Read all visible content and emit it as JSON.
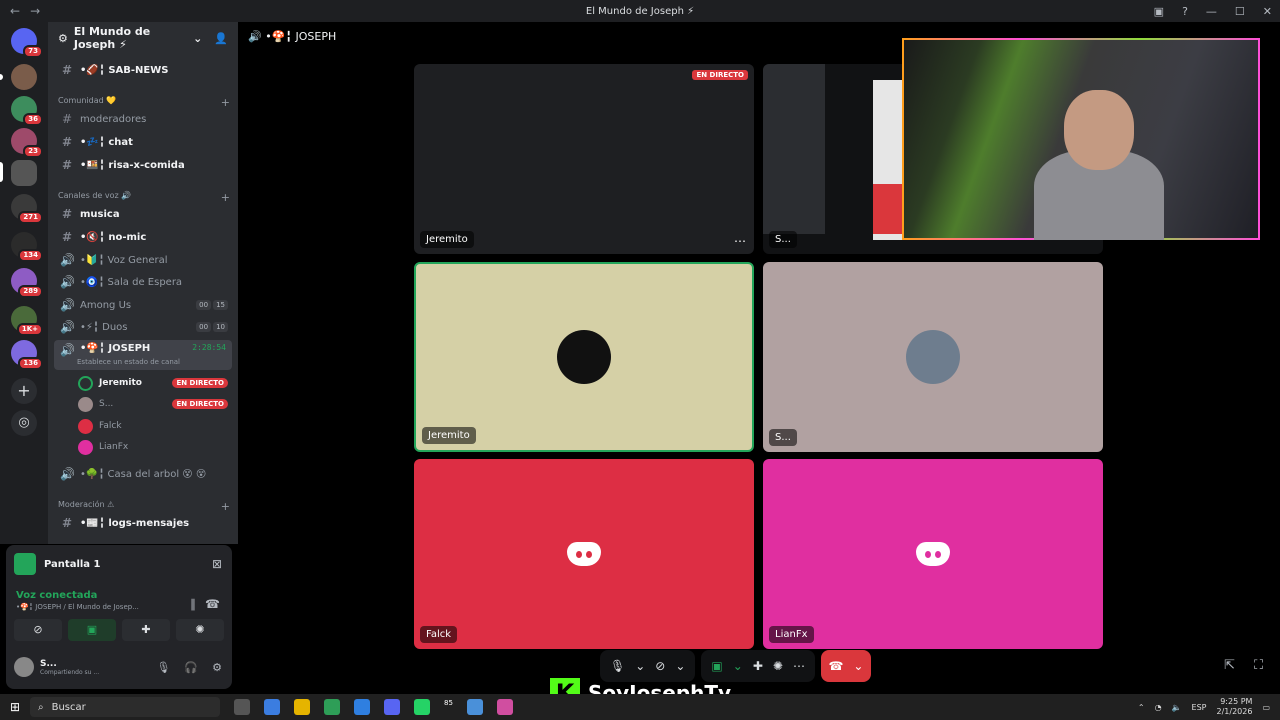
{
  "window": {
    "title": "El Mundo de Joseph ⚡"
  },
  "server": {
    "name": "El Mundo de Joseph ⚡"
  },
  "rail": {
    "badges": [
      "73",
      "36",
      "23",
      "271",
      "134",
      "289",
      "1K+",
      "136"
    ]
  },
  "channels": {
    "top": [
      {
        "icon": "#",
        "label": "•🏈╏ SAB-NEWS",
        "bright": true
      }
    ],
    "categories": [
      {
        "label": "Comunidad 💛"
      },
      {
        "label": "Canales de voz 🔊"
      },
      {
        "label": "Moderación ⚠"
      }
    ],
    "comunidad": [
      {
        "label": "moderadores"
      },
      {
        "label": "•💤╏ chat"
      },
      {
        "label": "•🍱╏ risa-x-comida"
      }
    ],
    "voz": [
      {
        "label": "musica"
      },
      {
        "label": "•🔇╏ no-mic"
      },
      {
        "label": "•🔰╏ Voz General"
      },
      {
        "label": "•🧿╏ Sala de Espera"
      },
      {
        "label": "Among Us",
        "counts": [
          "00",
          "15"
        ]
      },
      {
        "label": "•⚡╏ Duos",
        "counts": [
          "00",
          "10"
        ]
      },
      {
        "label": "•🍄╏ JOSEPH",
        "timer": "2:28:54"
      }
    ],
    "channel_status": "Establece un estado de canal",
    "voice_users": [
      {
        "name": "Jeremito",
        "live": "EN DIRECTO"
      },
      {
        "name": "S...",
        "live": "EN DIRECTO"
      },
      {
        "name": "Falck"
      },
      {
        "name": "LianFx"
      }
    ],
    "after": {
      "label": "•🌳╏ Casa del arbol 😵 😵"
    },
    "moderacion": [
      {
        "label": "•📰╏ logs-mensajes"
      }
    ]
  },
  "panel": {
    "screen_label": "Pantalla 1",
    "voice_status": "Voz conectada",
    "voice_location": "•🍄╏ JOSEPH / El Mundo de Josep...",
    "user_name": "S...",
    "user_status": "Compartiendo su ..."
  },
  "main": {
    "channel_title": "•🍄╏ JOSEPH",
    "tiles": [
      {
        "name": "Jeremito",
        "live": "EN DIRECTO",
        "bg": "#1e1f22"
      },
      {
        "name": "S...",
        "bg": "#111214"
      },
      {
        "name": "Jeremito",
        "bg": "#d5d0a6",
        "speaking": true
      },
      {
        "name": "S...",
        "bg": "#b1a1a1"
      },
      {
        "name": "Falck",
        "bg": "#dd2e44"
      },
      {
        "name": "LianFx",
        "bg": "#e02fa0"
      }
    ]
  },
  "overlay": {
    "brand": "SoyJosephTv"
  },
  "taskbar": {
    "search_placeholder": "Buscar",
    "lang": "ESP",
    "time": "9:25 PM",
    "date": "2/1/2026",
    "badge": "85"
  },
  "colors": {
    "accent": "#5865f2",
    "online": "#23a55a",
    "danger": "#da373c"
  }
}
